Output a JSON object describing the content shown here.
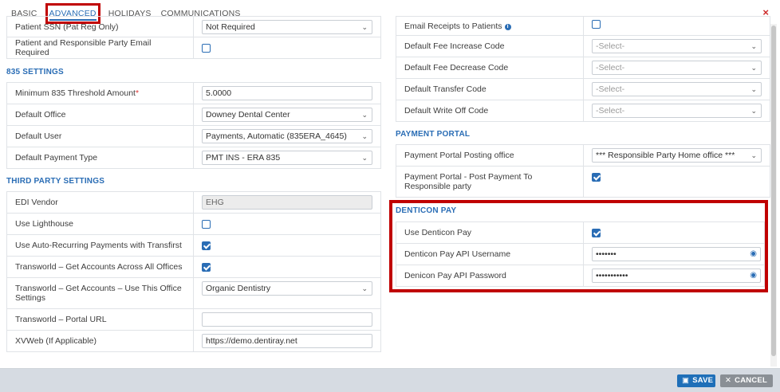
{
  "tabs": [
    {
      "label": "BASIC"
    },
    {
      "label": "ADVANCED"
    },
    {
      "label": "HOLIDAYS"
    },
    {
      "label": "COMMUNICATIONS"
    }
  ],
  "close_icon": "×",
  "left": {
    "top_rows": [
      {
        "label": "Patient SSN (Pat Reg Only)",
        "value": "Not Required"
      },
      {
        "label": "Patient and Responsible Party Email Required",
        "checked": false
      }
    ],
    "s835": {
      "title": "835 SETTINGS",
      "min_threshold_label": "Minimum 835 Threshold Amount",
      "min_threshold_required": "*",
      "min_threshold_value": "5.0000",
      "default_office_label": "Default Office",
      "default_office_value": "Downey Dental Center",
      "default_user_label": "Default User",
      "default_user_value": "Payments, Automatic (835ERA_4645)",
      "default_payment_type_label": "Default Payment Type",
      "default_payment_type_value": "PMT INS - ERA 835"
    },
    "third_party": {
      "title": "THIRD PARTY SETTINGS",
      "edi_vendor_label": "EDI Vendor",
      "edi_vendor_value": "EHG",
      "use_lighthouse_label": "Use Lighthouse",
      "use_lighthouse_checked": false,
      "auto_recurring_label": "Use Auto-Recurring Payments with Transfirst",
      "auto_recurring_checked": true,
      "tw_all_offices_label": "Transworld – Get Accounts Across All Offices",
      "tw_all_offices_checked": true,
      "tw_this_office_label": "Transworld – Get Accounts – Use This Office Settings",
      "tw_this_office_value": "Organic Dentistry",
      "tw_portal_label": "Transworld – Portal URL",
      "tw_portal_value": "",
      "xvweb_label": "XVWeb (If Applicable)",
      "xvweb_value": "https://demo.dentiray.net"
    }
  },
  "right": {
    "top_rows": {
      "email_receipts_label": "Email Receipts to Patients",
      "email_receipts_checked": false,
      "fee_increase_label": "Default Fee Increase Code",
      "fee_decrease_label": "Default Fee Decrease Code",
      "transfer_label": "Default Transfer Code",
      "write_off_label": "Default Write Off Code",
      "select_placeholder": "-Select-"
    },
    "payment_portal": {
      "title": "PAYMENT PORTAL",
      "posting_office_label": "Payment Portal Posting office",
      "posting_office_value": "*** Responsible Party Home office ***",
      "post_to_rp_label": "Payment Portal - Post Payment To Responsible party",
      "post_to_rp_checked": true
    },
    "denticon_pay": {
      "title": "DENTICON PAY",
      "use_label": "Use Denticon Pay",
      "use_checked": true,
      "username_label": "Denticon Pay API Username",
      "username_value": "•••••••",
      "password_label": "Denicon Pay API Password",
      "password_value": "•••••••••••"
    }
  },
  "footer": {
    "save_label": "SAVE",
    "cancel_label": "CANCEL"
  },
  "colors": {
    "accent": "#2a6db5",
    "highlight": "#c00000",
    "close": "#cc2a2a"
  }
}
